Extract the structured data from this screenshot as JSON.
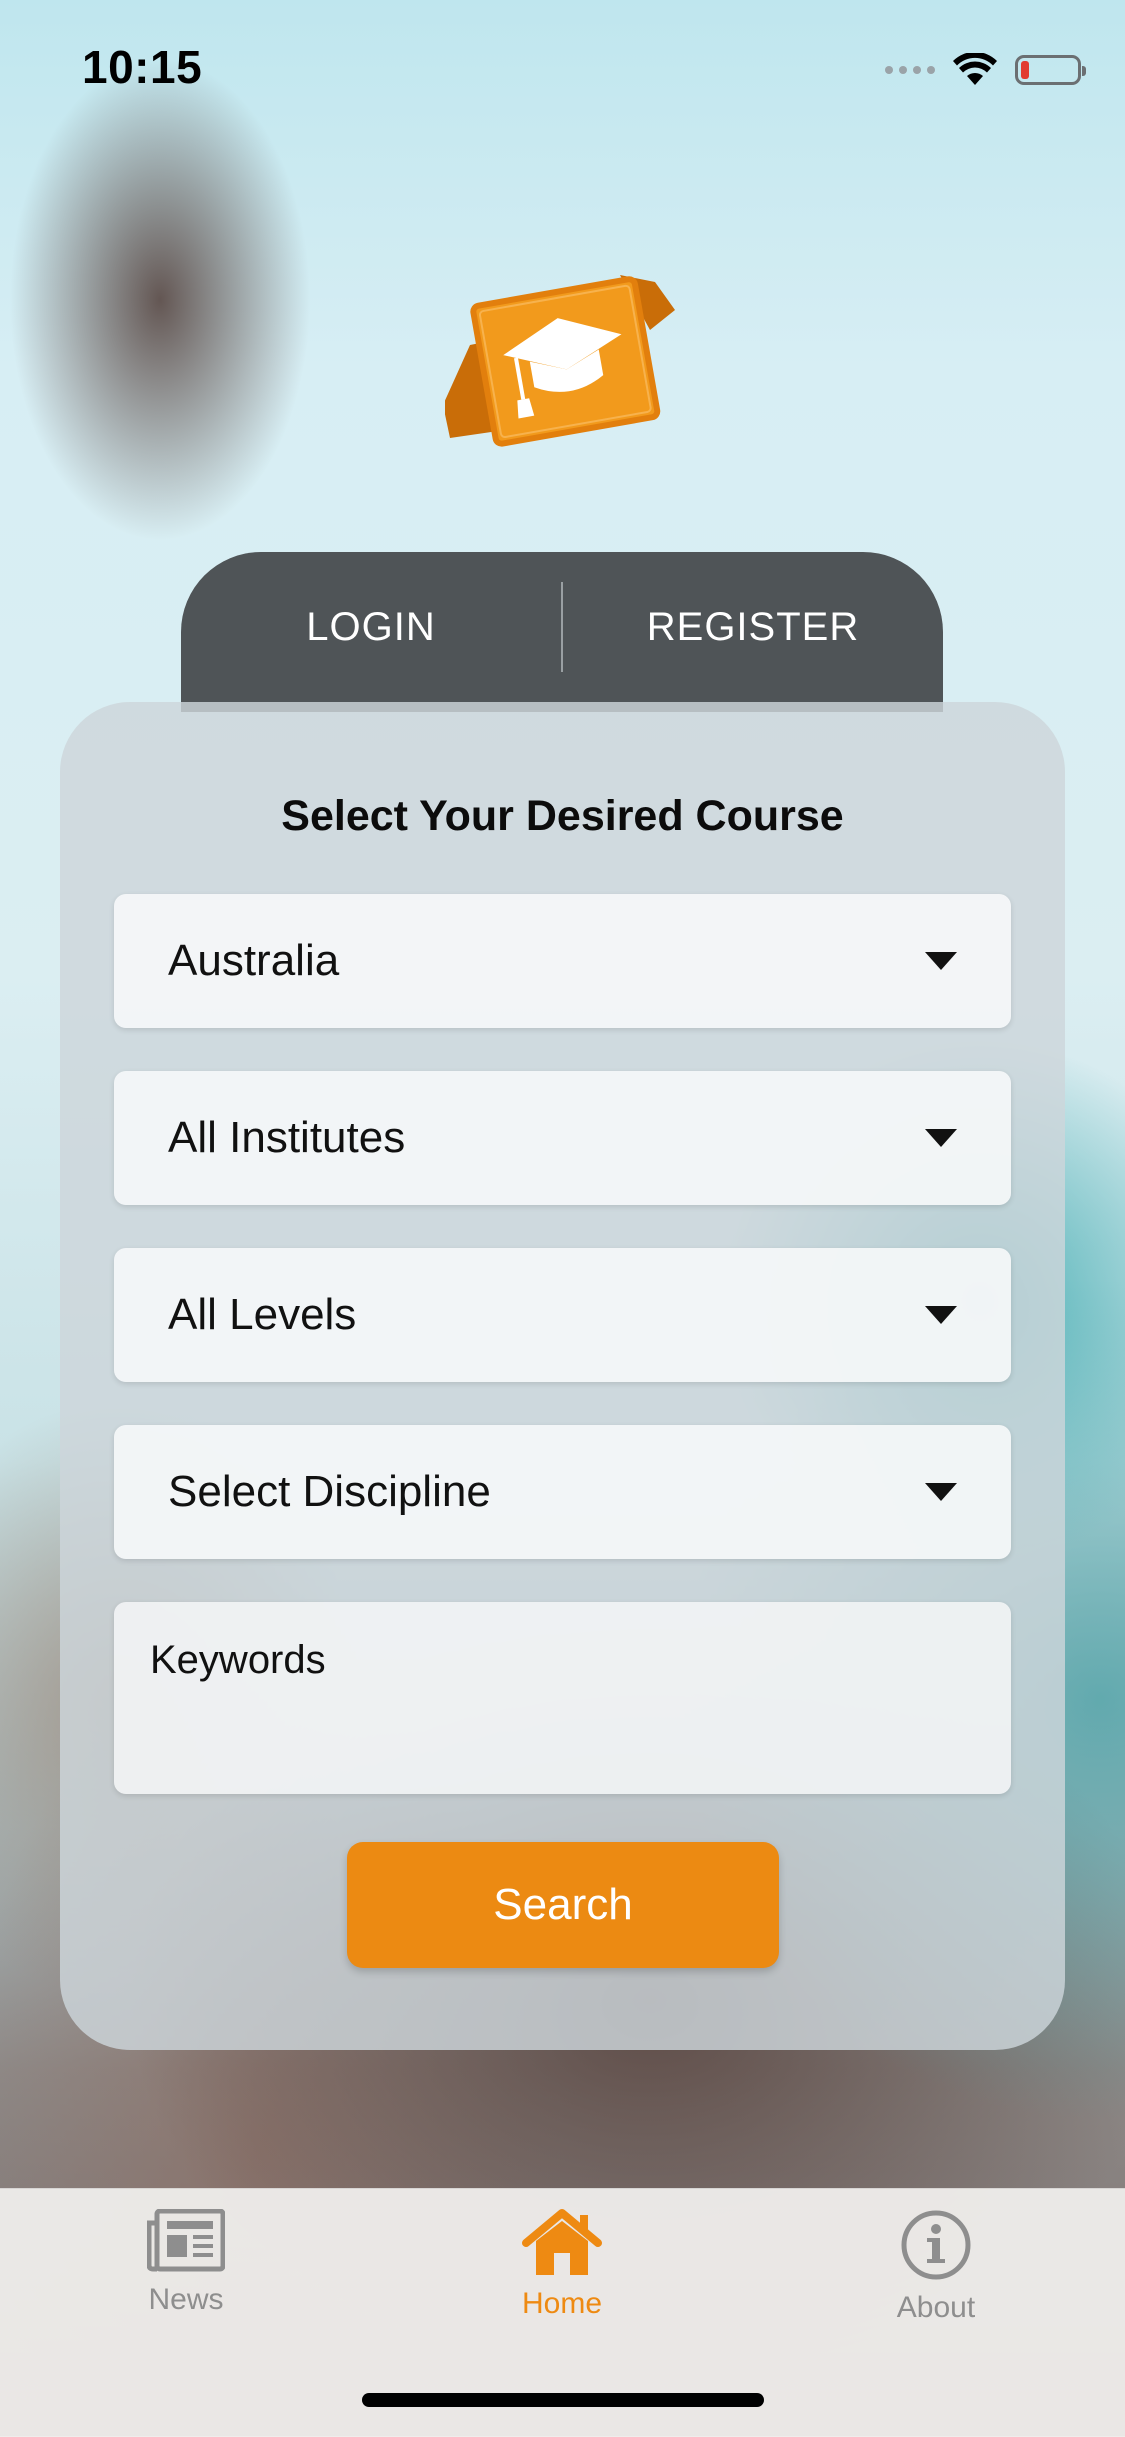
{
  "status_bar": {
    "time": "10:15",
    "icons": [
      "cellular-signal-icon",
      "wifi-icon",
      "battery-icon"
    ]
  },
  "logo": {
    "icon": "graduation-cap-icon",
    "colors": {
      "main": "#f29a1c",
      "dark": "#c96d08",
      "cap": "#ffffff"
    }
  },
  "auth_tabs": {
    "login_label": "LOGIN",
    "register_label": "REGISTER"
  },
  "course_search": {
    "title": "Select Your Desired Course",
    "country": {
      "selected": "Australia"
    },
    "institute": {
      "selected": "All Institutes"
    },
    "level": {
      "selected": "All Levels"
    },
    "discipline": {
      "selected": "Select Discipline"
    },
    "keywords": {
      "placeholder": "Keywords",
      "value": ""
    },
    "search_label": "Search"
  },
  "tab_bar": {
    "items": [
      {
        "label": "News",
        "icon": "newspaper-icon",
        "active": false
      },
      {
        "label": "Home",
        "icon": "home-icon",
        "active": true
      },
      {
        "label": "About",
        "icon": "info-icon",
        "active": false
      }
    ]
  },
  "colors": {
    "accent": "#ec8a12",
    "tab_header": "#4f5457",
    "inactive_tab": "#8e8e8e"
  }
}
